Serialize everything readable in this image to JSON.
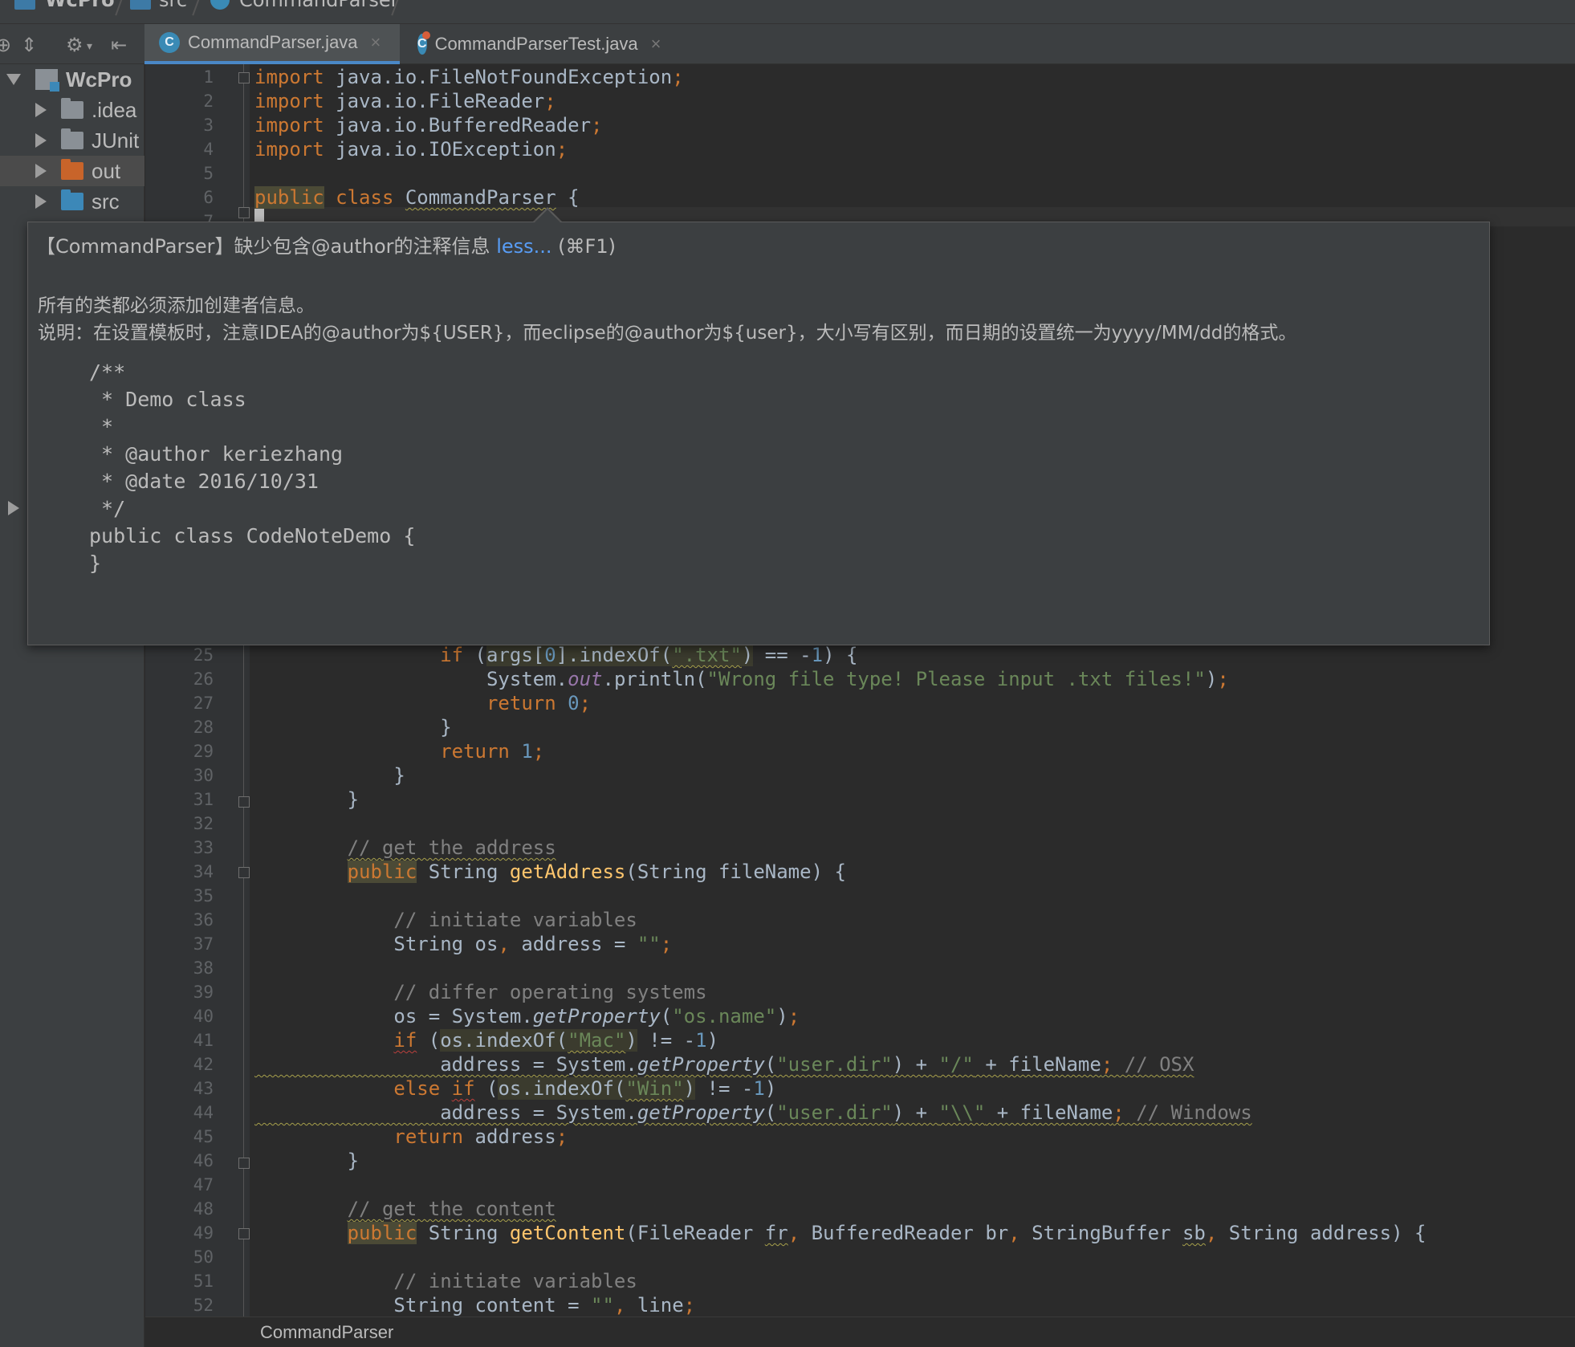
{
  "navbar": {
    "project": "WcPro",
    "folder": "src",
    "file": "CommandParser"
  },
  "tabs": [
    {
      "label": "CommandParser.java",
      "icon": "class-icon",
      "active": true
    },
    {
      "label": "CommandParserTest.java",
      "icon": "class-icon",
      "active": false
    }
  ],
  "tab_close_glyph": "×",
  "project_tree": {
    "root": "WcPro",
    "items": [
      ".idea",
      "JUnit",
      "out",
      "src"
    ]
  },
  "editor": {
    "top_lines": [
      "1",
      "2",
      "3",
      "4",
      "5",
      "6",
      "7"
    ],
    "bottom_lines": [
      "25",
      "26",
      "27",
      "28",
      "29",
      "30",
      "31",
      "32",
      "33",
      "34",
      "35",
      "36",
      "37",
      "38",
      "39",
      "40",
      "41",
      "42",
      "43",
      "44",
      "45",
      "46",
      "47",
      "48",
      "49",
      "50",
      "51",
      "52"
    ]
  },
  "tooltip": {
    "title_prefix": "【CommandParser】缺少包含@author的注释信息 ",
    "title_link": "less...",
    "title_shortcut": " (⌘F1)",
    "line1": "所有的类都必须添加创建者信息。",
    "line2": "说明：在设置模板时，注意IDEA的@author为${USER}，而eclipse的@author为${user}，大小写有区别，而日期的设置统一为yyyy/MM/dd的格式。",
    "code": [
      "/**",
      " * Demo class",
      " *",
      " * @author keriezhang",
      " * @date 2016/10/31",
      " */",
      "public class CodeNoteDemo {",
      "}"
    ]
  },
  "status_breadcrumb": "CommandParser",
  "colors": {
    "keyword": "#cc7832",
    "string": "#6a8759",
    "number": "#6897bb",
    "comment": "#808080",
    "method": "#ffc66d",
    "link": "#589df6"
  }
}
